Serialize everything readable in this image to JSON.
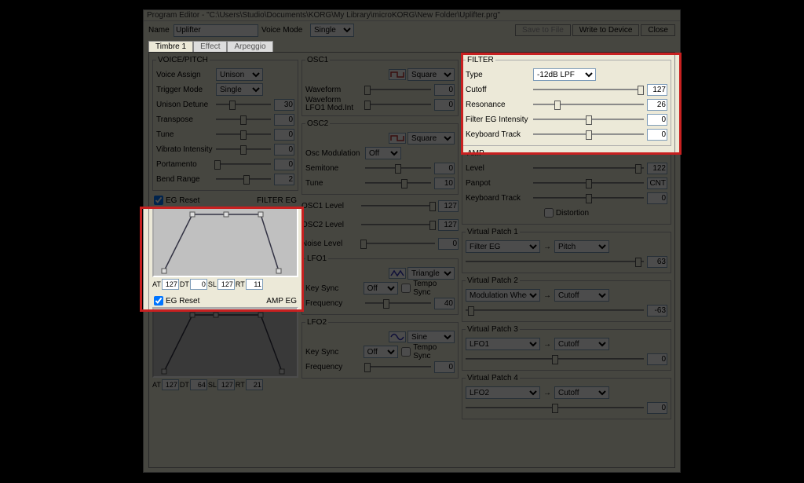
{
  "window": {
    "title": "Program Editor - \"C:\\Users\\Studio\\Documents\\KORG\\My Library\\microKORG\\New Folder\\Uplifter.prg\""
  },
  "top": {
    "name_label": "Name",
    "name_value": "Uplifter",
    "voicemode_label": "Voice Mode",
    "voicemode_value": "Single",
    "save_btn": "Save to File",
    "write_btn": "Write to Device",
    "close_btn": "Close"
  },
  "tabs": [
    "Timbre 1",
    "Effect",
    "Arpeggio"
  ],
  "voice": {
    "legend": "VOICE/PITCH",
    "assign_label": "Voice Assign",
    "assign_value": "Unison",
    "trigger_label": "Trigger Mode",
    "trigger_value": "Single",
    "detune_label": "Unison Detune",
    "detune_value": "30",
    "transpose_label": "Transpose",
    "transpose_value": "0",
    "tune_label": "Tune",
    "tune_value": "0",
    "vibrato_label": "Vibrato Intensity",
    "vibrato_value": "0",
    "portamento_label": "Portamento",
    "portamento_value": "0",
    "bend_label": "Bend Range",
    "bend_value": "2"
  },
  "filter_eg": {
    "reset_label": "EG Reset",
    "title": "FILTER EG",
    "at_l": "AT",
    "at": "127",
    "dt_l": "DT",
    "dt": "0",
    "sl_l": "SL",
    "sl": "127",
    "rt_l": "RT",
    "rt": "11"
  },
  "amp_eg": {
    "reset_label": "EG Reset",
    "title": "AMP EG",
    "at_l": "AT",
    "at": "127",
    "dt_l": "DT",
    "dt": "64",
    "sl_l": "SL",
    "sl": "127",
    "rt_l": "RT",
    "rt": "21"
  },
  "osc1": {
    "legend": "OSC1",
    "wave_value": "Square",
    "waveform_label": "Waveform",
    "waveform_value": "0",
    "lfo1mod_label": "Waveform LFO1 Mod.Int",
    "lfo1mod_value": "0"
  },
  "osc2": {
    "legend": "OSC2",
    "wave_value": "Square",
    "oscmod_label": "Osc Modulation",
    "oscmod_value": "Off",
    "semitone_label": "Semitone",
    "semitone_value": "0",
    "tune_label": "Tune",
    "tune_value": "10"
  },
  "mixer": {
    "osc1l_label": "OSC1 Level",
    "osc1l_value": "127",
    "osc2l_label": "OSC2 Level",
    "osc2l_value": "127",
    "noise_label": "Noise Level",
    "noise_value": "0"
  },
  "lfo1": {
    "legend": "LFO1",
    "wave_value": "Triangle",
    "keysync_label": "Key Sync",
    "keysync_value": "Off",
    "tempo_label": "Tempo Sync",
    "freq_label": "Frequency",
    "freq_value": "40"
  },
  "lfo2": {
    "legend": "LFO2",
    "wave_value": "Sine",
    "keysync_label": "Key Sync",
    "keysync_value": "Off",
    "tempo_label": "Tempo Sync",
    "freq_label": "Frequency",
    "freq_value": "0"
  },
  "filter": {
    "legend": "FILTER",
    "type_label": "Type",
    "type_value": "-12dB LPF",
    "cutoff_label": "Cutoff",
    "cutoff_value": "127",
    "res_label": "Resonance",
    "res_value": "26",
    "egint_label": "Filter EG Intensity",
    "egint_value": "0",
    "kbd_label": "Keyboard Track",
    "kbd_value": "0"
  },
  "amp": {
    "legend": "AMP",
    "level_label": "Level",
    "level_value": "122",
    "pan_label": "Panpot",
    "pan_value": "CNT",
    "kbd_label": "Keyboard Track",
    "kbd_value": "0",
    "dist_label": "Distortion"
  },
  "vp1": {
    "legend": "Virtual Patch 1",
    "src": "Filter EG",
    "dst": "Pitch",
    "amt": "63"
  },
  "vp2": {
    "legend": "Virtual Patch 2",
    "src": "Modulation Wheel",
    "dst": "Cutoff",
    "amt": "-63"
  },
  "vp3": {
    "legend": "Virtual Patch 3",
    "src": "LFO1",
    "dst": "Cutoff",
    "amt": "0"
  },
  "vp4": {
    "legend": "Virtual Patch 4",
    "src": "LFO2",
    "dst": "Cutoff",
    "amt": "0"
  }
}
